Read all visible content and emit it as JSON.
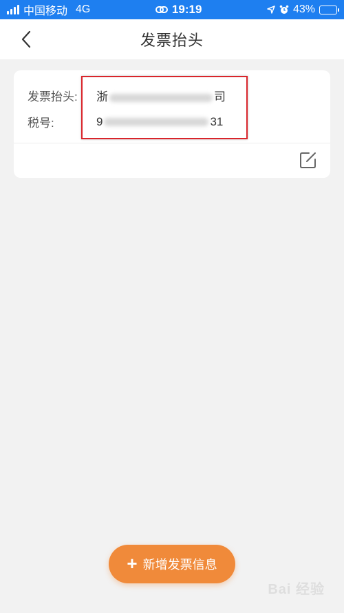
{
  "status_bar": {
    "carrier": "中国移动",
    "network": "4G",
    "time": "19:19",
    "battery": "43%",
    "battery_level": 0.43
  },
  "header": {
    "title": "发票抬头"
  },
  "card": {
    "title_label": "发票抬头:",
    "title_value_start": "浙",
    "title_value_end": "司",
    "tax_label": "税号:",
    "tax_value_start": "9",
    "tax_value_end": "31"
  },
  "actions": {
    "add_label": "新增发票信息"
  },
  "watermark": {
    "text": "Bai 经验"
  },
  "colors": {
    "status_bar": "#1e7ff0",
    "accent": "#f08a3a",
    "highlight": "#d9252b"
  }
}
